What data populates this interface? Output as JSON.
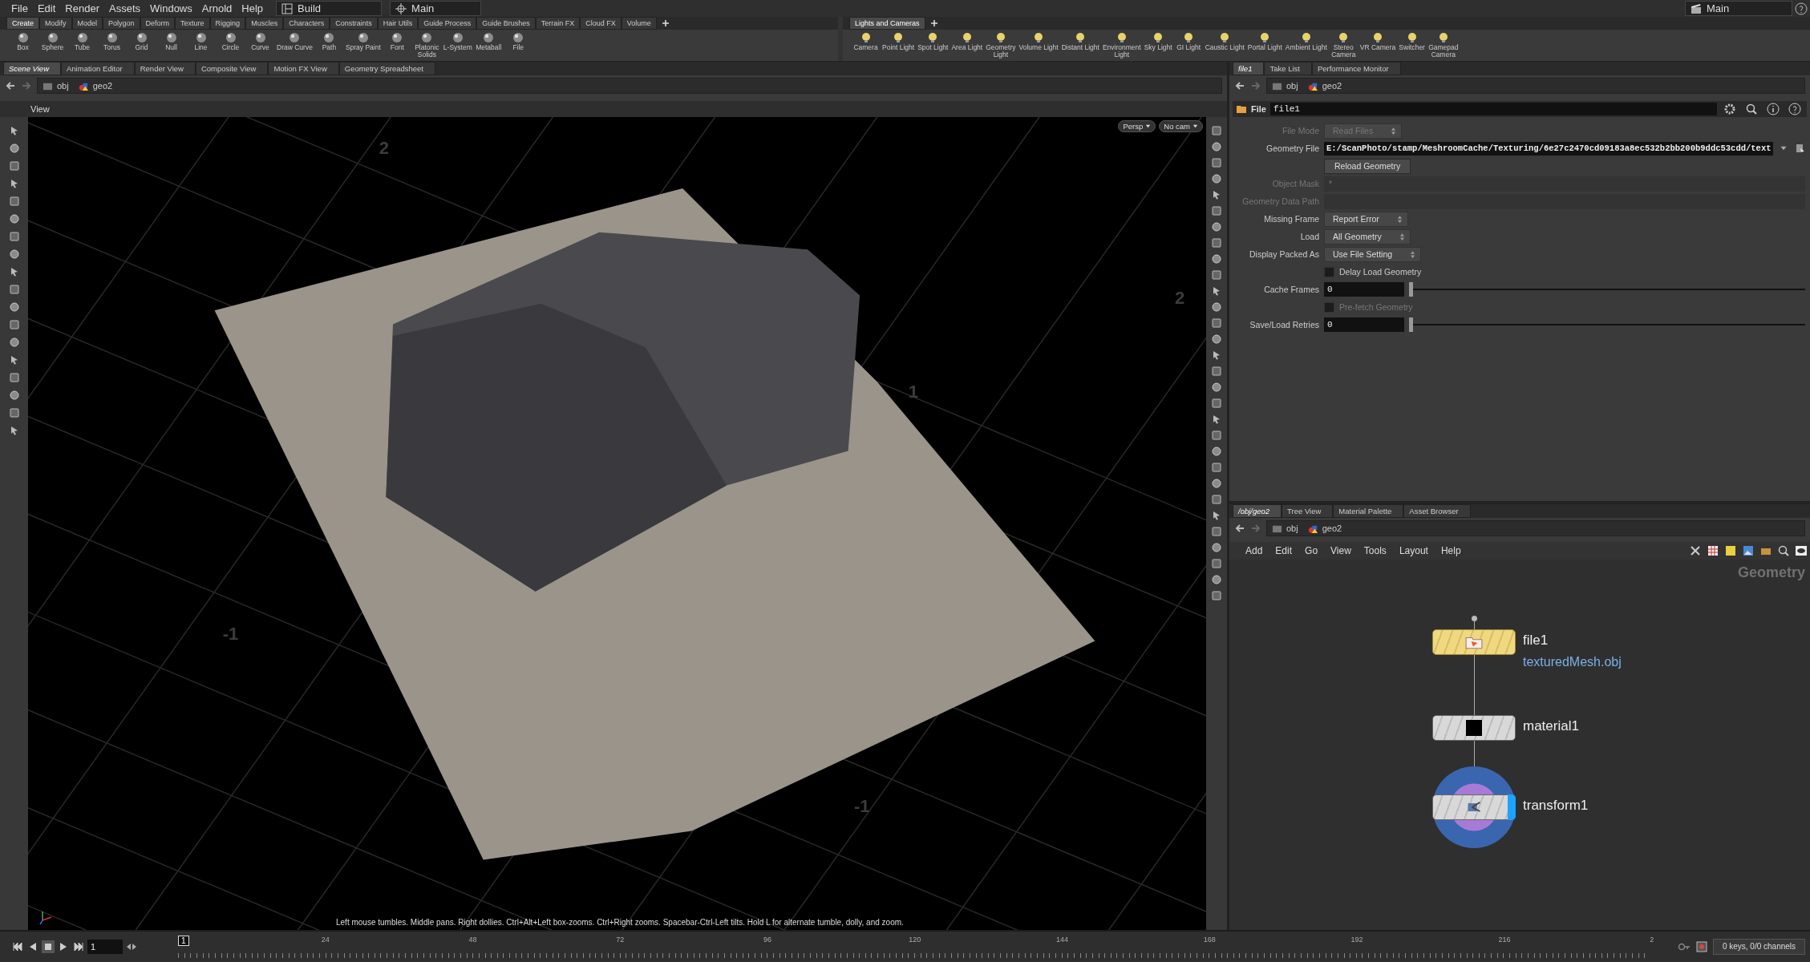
{
  "menu": [
    "File",
    "Edit",
    "Render",
    "Assets",
    "Windows",
    "Arnold",
    "Help"
  ],
  "desktop_selector": "Build",
  "shelf_set_selector": "Main",
  "right_selector": "Main",
  "shelf_tabs": [
    {
      "label": "Create",
      "selected": true
    },
    {
      "label": "Modify",
      "selected": false
    },
    {
      "label": "Model",
      "selected": false
    },
    {
      "label": "Polygon",
      "selected": false
    },
    {
      "label": "Deform",
      "selected": false
    },
    {
      "label": "Texture",
      "selected": false
    },
    {
      "label": "Rigging",
      "selected": false
    },
    {
      "label": "Muscles",
      "selected": false
    },
    {
      "label": "Characters",
      "selected": false
    },
    {
      "label": "Constraints",
      "selected": false
    },
    {
      "label": "Hair Utils",
      "selected": false
    },
    {
      "label": "Guide Process",
      "selected": false
    },
    {
      "label": "Guide Brushes",
      "selected": false
    },
    {
      "label": "Terrain FX",
      "selected": false
    },
    {
      "label": "Cloud FX",
      "selected": false
    },
    {
      "label": "Volume",
      "selected": false
    }
  ],
  "shelf_tools": [
    "Box",
    "Sphere",
    "Tube",
    "Torus",
    "Grid",
    "Null",
    "Line",
    "Circle",
    "Curve",
    "Draw Curve",
    "Path",
    "Spray Paint",
    "Font",
    "Platonic\nSolids",
    "L-System",
    "Metaball",
    "File"
  ],
  "light_tabs": [
    {
      "label": "Lights and Cameras",
      "selected": true
    }
  ],
  "light_tools": [
    "Camera",
    "Point Light",
    "Spot Light",
    "Area Light",
    "Geometry\nLight",
    "Volume Light",
    "Distant Light",
    "Environment\nLight",
    "Sky Light",
    "GI Light",
    "Caustic Light",
    "Portal Light",
    "Ambient Light",
    "Stereo\nCamera",
    "VR Camera",
    "Switcher",
    "Gamepad\nCamera"
  ],
  "scene_pane": {
    "tabs": [
      {
        "label": "Scene View",
        "selected": true
      },
      {
        "label": "Animation Editor",
        "selected": false
      },
      {
        "label": "Render View",
        "selected": false
      },
      {
        "label": "Composite View",
        "selected": false
      },
      {
        "label": "Motion FX View",
        "selected": false
      },
      {
        "label": "Geometry Spreadsheet",
        "selected": false
      }
    ],
    "path": [
      "obj",
      "geo2"
    ],
    "viewport": {
      "title": "View",
      "camera_menus": [
        "Persp",
        "No cam"
      ],
      "grid_labels": [
        "2",
        "2",
        "1",
        "-1",
        "-1"
      ],
      "hint": "Left mouse tumbles. Middle pans. Right dollies. Ctrl+Alt+Left box-zooms. Ctrl+Right zooms. Spacebar-Ctrl-Left tilts. Hold L for alternate tumble, dolly, and zoom."
    }
  },
  "parameter_pane": {
    "tabs": [
      {
        "label": "file1",
        "selected": true
      },
      {
        "label": "Take List",
        "selected": false
      },
      {
        "label": "Performance Monitor",
        "selected": false
      }
    ],
    "path": [
      "obj",
      "geo2"
    ],
    "node_type": "File",
    "node_name": "file1",
    "params": [
      {
        "kind": "menu",
        "label": "File Mode",
        "value": "Read Files",
        "disabled": true
      },
      {
        "kind": "file",
        "label": "Geometry File",
        "value": "E:/ScanPhoto/stamp/MeshroomCache/Texturing/6e27c2470cd09183a8ec532b2bb200b9ddc53cdd/text",
        "disabled": false
      },
      {
        "kind": "button",
        "label": "Reload Geometry"
      },
      {
        "kind": "text",
        "label": "Object Mask",
        "value": "*",
        "disabled": true
      },
      {
        "kind": "text",
        "label": "Geometry Data Path",
        "disabled": true
      },
      {
        "kind": "menu",
        "label": "Missing Frame",
        "value": "Report Error",
        "disabled": false
      },
      {
        "kind": "menu",
        "label": "Load",
        "value": "All Geometry",
        "disabled": false
      },
      {
        "kind": "menu",
        "label": "Display Packed As",
        "value": "Use File Setting",
        "disabled": false
      },
      {
        "kind": "checkbox",
        "label": "Delay Load Geometry",
        "disabled": false,
        "checked": false
      },
      {
        "kind": "slider",
        "label": "Cache Frames",
        "value": "0",
        "level": 0,
        "disabled": false
      },
      {
        "kind": "checkbox",
        "label": "Pre-fetch Geometry",
        "disabled": true,
        "checked": false
      },
      {
        "kind": "slider",
        "label": "Save/Load Retries",
        "value": "0",
        "level": 0,
        "disabled": false
      }
    ]
  },
  "network_pane": {
    "tabs": [
      {
        "label": "/obj/geo2",
        "selected": true
      },
      {
        "label": "Tree View",
        "selected": false
      },
      {
        "label": "Material Palette",
        "selected": false
      },
      {
        "label": "Asset Browser",
        "selected": false
      }
    ],
    "path": [
      "obj",
      "geo2"
    ],
    "menu": [
      "Add",
      "Edit",
      "Go",
      "View",
      "Tools",
      "Layout",
      "Help"
    ],
    "context": "Geometry",
    "nodes": [
      {
        "kind": "file",
        "name": "file1",
        "detail": "texturedMesh.obj",
        "display": false
      },
      {
        "kind": "material",
        "name": "material1",
        "display": false
      },
      {
        "kind": "transform",
        "name": "transform1",
        "display": true
      }
    ]
  },
  "timeline": {
    "frame": "1",
    "current_frame": "1",
    "ticks": [
      "24",
      "48",
      "72",
      "96",
      "120",
      "144",
      "168",
      "192",
      "216",
      "2"
    ],
    "status": "0 keys, 0/0 channels"
  }
}
